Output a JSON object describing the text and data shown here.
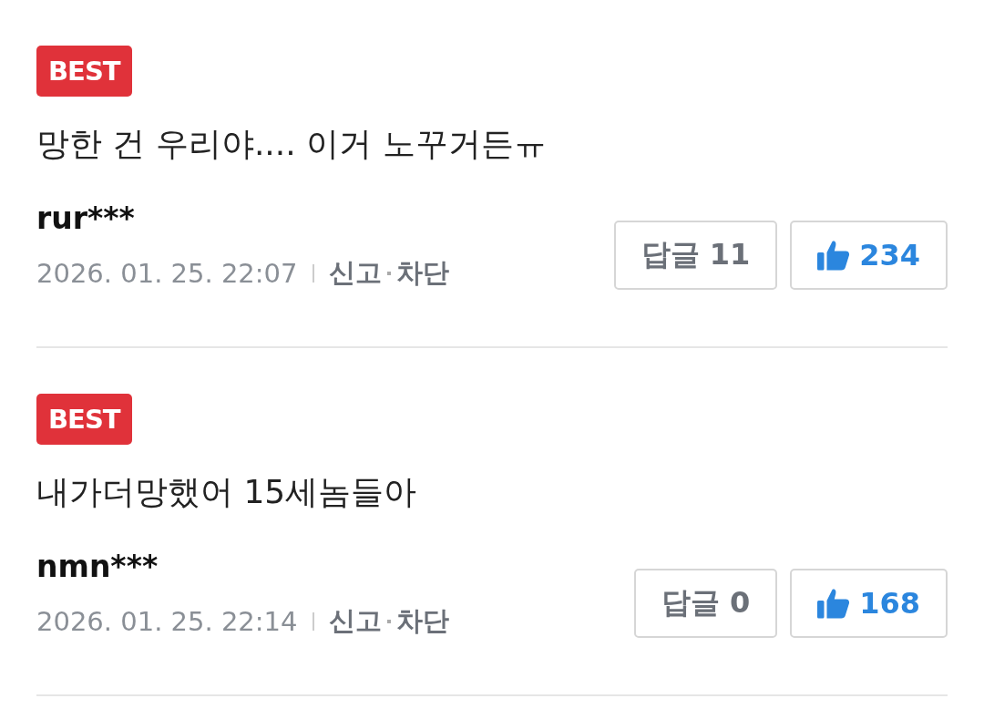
{
  "comments": [
    {
      "badge": "BEST",
      "text": "망한 건 우리야.... 이거 노꾸거든ㅠ",
      "user": "rur***",
      "date": "2026. 01. 25. 22:07",
      "actions": [
        "신고",
        "차단"
      ],
      "reply": "답글 11",
      "likes": "234"
    },
    {
      "badge": "BEST",
      "text": "내가더망했어 15세놈들아",
      "user": "nmn***",
      "date": "2026. 01. 25. 22:14",
      "actions": [
        "신고",
        "차단"
      ],
      "reply": "답글 0",
      "likes": "168"
    }
  ]
}
